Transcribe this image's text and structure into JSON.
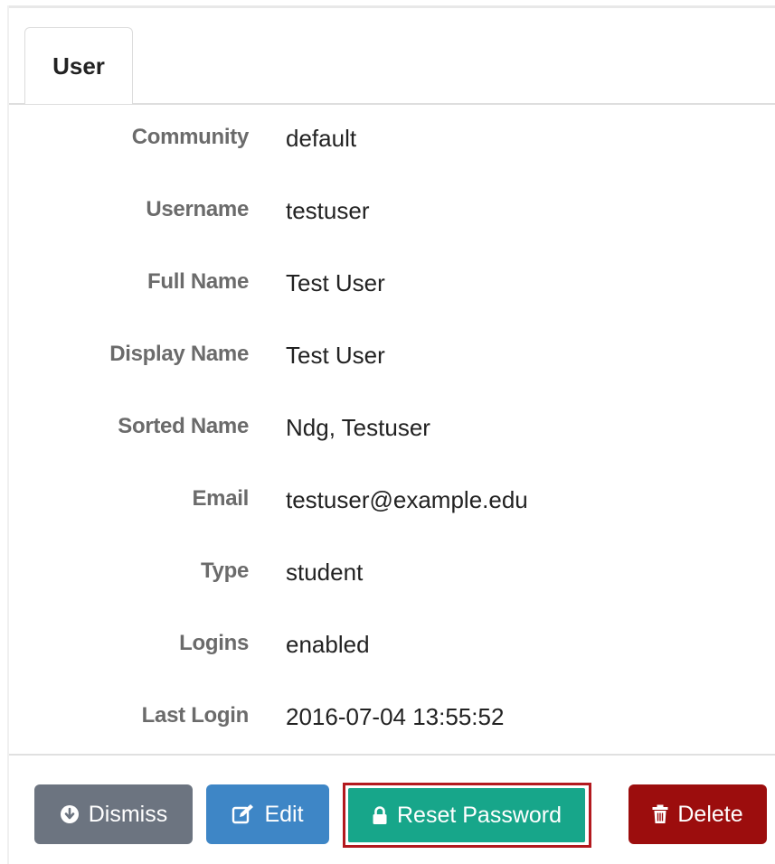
{
  "tabs": [
    {
      "label": "User"
    }
  ],
  "fields": [
    {
      "label": "Community",
      "value": "default"
    },
    {
      "label": "Username",
      "value": "testuser"
    },
    {
      "label": "Full Name",
      "value": "Test User"
    },
    {
      "label": "Display Name",
      "value": "Test User"
    },
    {
      "label": "Sorted Name",
      "value": "Ndg, Testuser"
    },
    {
      "label": "Email",
      "value": "testuser@example.edu"
    },
    {
      "label": "Type",
      "value": "student"
    },
    {
      "label": "Logins",
      "value": "enabled"
    },
    {
      "label": "Last Login",
      "value": "2016-07-04 13:55:52"
    }
  ],
  "actions": {
    "dismiss": {
      "label": "Dismiss",
      "icon": "arrow-circle-down-icon",
      "color": "#6c7480"
    },
    "edit": {
      "label": "Edit",
      "icon": "edit-icon",
      "color": "#3e86c6"
    },
    "reset_password": {
      "label": "Reset Password",
      "icon": "lock-icon",
      "color": "#17a68a",
      "highlight_color": "#b3191e"
    },
    "delete": {
      "label": "Delete",
      "icon": "trash-icon",
      "color": "#9c0d0d"
    }
  }
}
